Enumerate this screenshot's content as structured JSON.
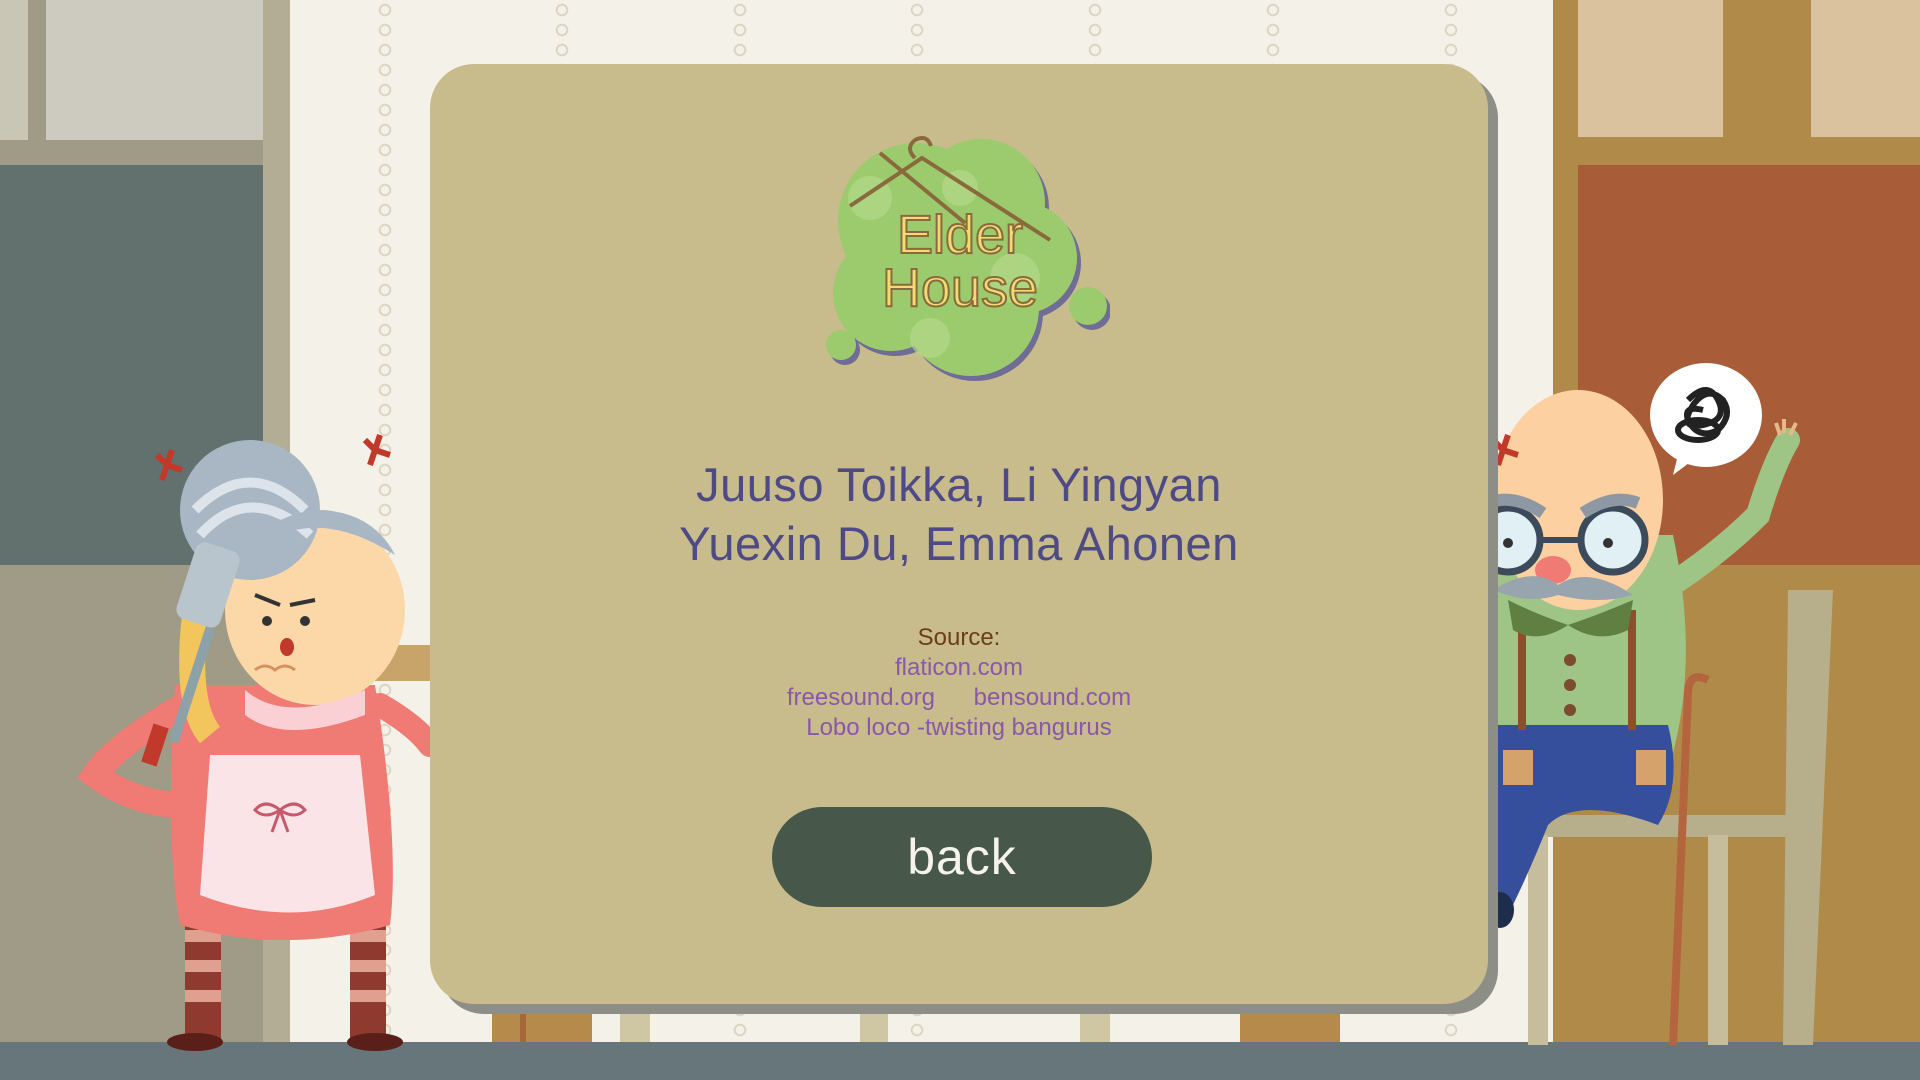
{
  "logo": {
    "line1": "Elder",
    "line2": "House"
  },
  "credits": {
    "line1": "Juuso Toikka, Li Yingyan",
    "line2": "Yuexin Du, Emma Ahonen"
  },
  "source": {
    "label": "Source:",
    "items": [
      "flaticon.com",
      "freesound.org",
      "bensound.com",
      "Lobo loco -twisting bangurus"
    ]
  },
  "back_label": "back",
  "colors": {
    "panel": "#c8bb8c",
    "button": "#47574a",
    "credits_text": "#4e4a86",
    "source_label": "#6b3d18",
    "source_links": "#8a58a8"
  }
}
